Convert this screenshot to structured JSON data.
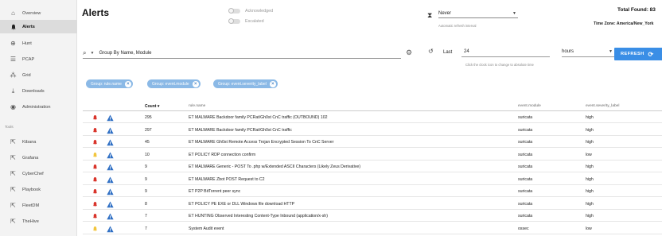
{
  "sidebar": {
    "items": [
      {
        "label": "Overview",
        "icon": "home-icon"
      },
      {
        "label": "Alerts",
        "icon": "bell-icon",
        "active": true
      },
      {
        "label": "Hunt",
        "icon": "crosshair-icon"
      },
      {
        "label": "PCAP",
        "icon": "list-icon"
      },
      {
        "label": "Grid",
        "icon": "grid-icon"
      },
      {
        "label": "Downloads",
        "icon": "download-icon"
      },
      {
        "label": "Administration",
        "icon": "shield-icon"
      }
    ],
    "tools_header": "Tools",
    "tools": [
      {
        "label": "Kibana",
        "icon": "external-link-icon"
      },
      {
        "label": "Grafana",
        "icon": "external-link-icon"
      },
      {
        "label": "CyberChef",
        "icon": "external-link-icon"
      },
      {
        "label": "Playbook",
        "icon": "external-link-icon"
      },
      {
        "label": "FleetDM",
        "icon": "external-link-icon"
      },
      {
        "label": "TheHive",
        "icon": "external-link-icon"
      }
    ]
  },
  "header": {
    "title": "Alerts",
    "toggle_acknowledged": "Acknowledged",
    "toggle_escalated": "Escalated",
    "auto_refresh_value": "Never",
    "auto_refresh_hint": "Automatic refresh interval",
    "total_found": "Total Found: 83",
    "timezone": "Time Zone: America/New_York"
  },
  "query": {
    "value": "Group By Name, Module",
    "last_label": "Last",
    "last_value": "24",
    "last_hint": "Click the clock icon to change to absolute time",
    "unit": "hours",
    "refresh_label": "REFRESH"
  },
  "chips": [
    "Group: rule.name",
    "Group: event.module",
    "Group: event.severity_label"
  ],
  "table": {
    "columns": [
      "Count",
      "rule.name",
      "event.module",
      "event.severity_label"
    ],
    "rows": [
      {
        "count": "295",
        "name": "ET MALWARE Backdoor family PCRat/Gh0st CnC traffic (OUTBOUND) 102",
        "module": "suricata",
        "severity": "high",
        "bell": "red"
      },
      {
        "count": "297",
        "name": "ET MALWARE Backdoor family PCRat/Gh0st CnC traffic",
        "module": "suricata",
        "severity": "high",
        "bell": "red"
      },
      {
        "count": "45",
        "name": "ET MALWARE Gh0st Remote Access Trojan Encrypted Session To CnC Server",
        "module": "suricata",
        "severity": "high",
        "bell": "red"
      },
      {
        "count": "10",
        "name": "ET POLICY RDP connection confirm",
        "module": "suricata",
        "severity": "low",
        "bell": "yellow"
      },
      {
        "count": "9",
        "name": "ET MALWARE Generic - POST To .php w/Extended ASCII Characters (Likely Zeus Derivative)",
        "module": "suricata",
        "severity": "high",
        "bell": "red"
      },
      {
        "count": "9",
        "name": "ET MALWARE Zbot POST Request to C2",
        "module": "suricata",
        "severity": "high",
        "bell": "red"
      },
      {
        "count": "9",
        "name": "ET P2P BitTorrent peer sync",
        "module": "suricata",
        "severity": "high",
        "bell": "red"
      },
      {
        "count": "8",
        "name": "ET POLICY PE EXE or DLL Windows file download HTTP",
        "module": "suricata",
        "severity": "high",
        "bell": "red"
      },
      {
        "count": "7",
        "name": "ET HUNTING Observed Interesting Content-Type Inbound (application/x-sh)",
        "module": "suricata",
        "severity": "high",
        "bell": "red"
      },
      {
        "count": "7",
        "name": "System Audit event",
        "module": "ossec",
        "severity": "low",
        "bell": "yellow"
      }
    ]
  },
  "colors": {
    "accent": "#3a8ee6",
    "chip": "#8bb9e6",
    "bell_red": "#d9342b",
    "bell_yellow": "#f2c53d",
    "triangle": "#2f6fc4"
  }
}
